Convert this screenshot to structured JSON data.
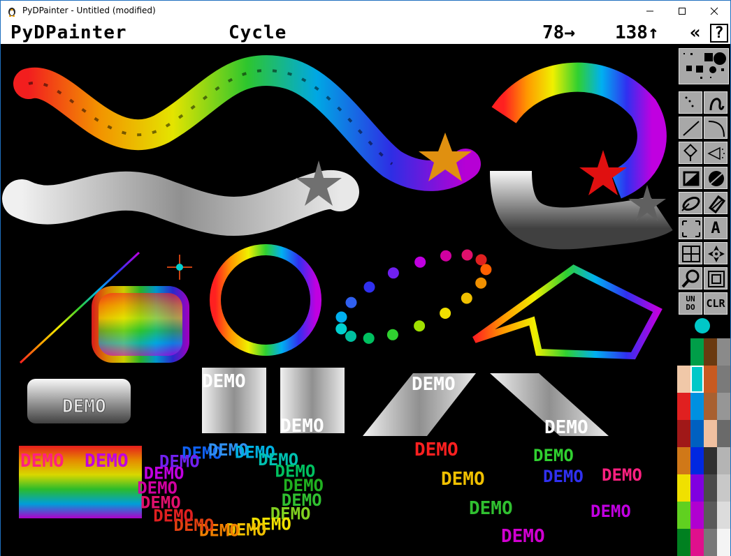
{
  "window": {
    "title": "PyDPainter - Untitled (modified)",
    "controls": [
      "minimize",
      "maximize",
      "close"
    ]
  },
  "menubar": {
    "app_name": "PyDPainter",
    "mode": "Cycle",
    "coord_x": "78→",
    "coord_y": "138↑",
    "collapse_glyph": "«",
    "help_glyph": "?"
  },
  "toolbox": {
    "tools": [
      {
        "name": "dotted-freehand",
        "icon": "dotted-line-icon"
      },
      {
        "name": "continuous-freehand",
        "icon": "freehand-curve-icon"
      },
      {
        "name": "line",
        "icon": "line-icon"
      },
      {
        "name": "curve",
        "icon": "curve-icon"
      },
      {
        "name": "fill",
        "icon": "fill-bucket-icon"
      },
      {
        "name": "airbrush",
        "icon": "airbrush-icon"
      },
      {
        "name": "rectangle",
        "icon": "rectangle-icon"
      },
      {
        "name": "circle",
        "icon": "circle-icon"
      },
      {
        "name": "ellipse",
        "icon": "ellipse-icon"
      },
      {
        "name": "polygon",
        "icon": "polygon-icon"
      },
      {
        "name": "brush-select",
        "icon": "brush-select-icon"
      },
      {
        "name": "text",
        "icon": "text-icon",
        "label": "A"
      },
      {
        "name": "grid",
        "icon": "grid-icon"
      },
      {
        "name": "symmetry",
        "icon": "symmetry-icon"
      },
      {
        "name": "magnify",
        "icon": "magnify-icon"
      },
      {
        "name": "zoom",
        "icon": "zoom-icon"
      },
      {
        "name": "undo",
        "icon": "undo-icon",
        "label_top": "UN",
        "label_bottom": "DO"
      },
      {
        "name": "clear",
        "icon": "clear-icon",
        "label": "CLR"
      }
    ],
    "foreground_color": "#00c8c8",
    "palette": [
      "#009e48",
      "#6a3a10",
      "#8a8a8a",
      "#f0c8a8",
      "#00c8c8",
      "#c85a20",
      "#7a7a7a",
      "#e02020",
      "#0090e0",
      "#a86030",
      "#969696",
      "#a01818",
      "#0060c0",
      "#f0c0a0",
      "#6a6a6a",
      "#d07818",
      "#0028e0",
      "#303030",
      "#b4b4b4",
      "#f0e000",
      "#8000e0",
      "#4a4a4a",
      "#c8c8c8",
      "#60d020",
      "#b000d0",
      "#5a5a5a",
      "#dcdcdc",
      "#008020",
      "#e0108c",
      "#787878",
      "#f4f4f4"
    ],
    "selected_index": 4
  },
  "canvas": {
    "demo_text": "DEMO"
  }
}
